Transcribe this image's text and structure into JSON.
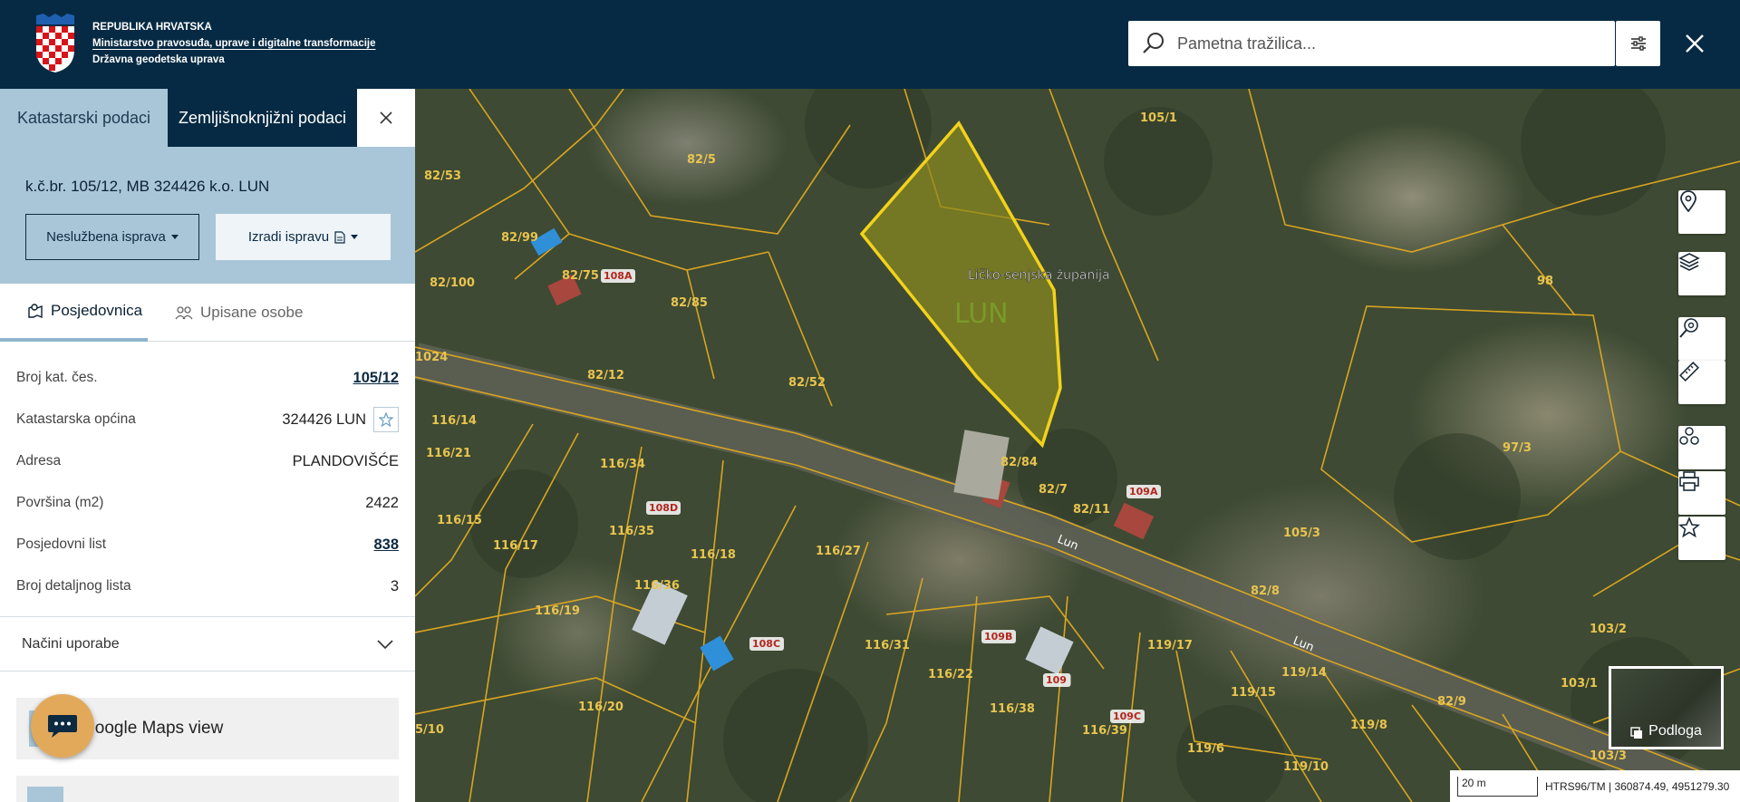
{
  "header": {
    "gov_line1": "REPUBLIKA HRVATSKA",
    "gov_line2": "Ministarstvo pravosuđa, uprave i digitalne transformacije",
    "gov_line3": "Državna geodetska uprava",
    "search_placeholder": "Pametna tražilica..."
  },
  "sidebar": {
    "tabs": [
      {
        "label": "Katastarski podaci"
      },
      {
        "label": "Zemljišnoknjižni podaci"
      }
    ],
    "parcel_title": "k.č.br. 105/12, MB 324426 k.o. LUN",
    "btn_unofficial": "Neslužbena isprava",
    "btn_create": "Izradi ispravu",
    "subtabs": [
      {
        "label": "Posjedovnica"
      },
      {
        "label": "Upisane osobe"
      }
    ],
    "info": [
      {
        "label": "Broj kat. čes.",
        "value": "105/12"
      },
      {
        "label": "Katastarska općina",
        "value": "324426 LUN"
      },
      {
        "label": "Adresa",
        "value": "PLANDOVIŠĆE"
      },
      {
        "label": "Površina (m2)",
        "value": "2422"
      },
      {
        "label": "Posjedovni list",
        "value": "838"
      },
      {
        "label": "Broj detaljnog lista",
        "value": "3"
      }
    ],
    "accordion_label": "Načini uporabe",
    "gmaps_label": "Google Maps view"
  },
  "map": {
    "county_label": "Ličko-senjska županija",
    "highlight_label": "LUN",
    "road_label": "Lun",
    "parcel_labels": [
      "105/1",
      "82/5",
      "82/53",
      "82/99",
      "82/75",
      "82/100",
      "82/85",
      "82/12",
      "82/52",
      "82/84",
      "82/7",
      "82/11",
      "116/14",
      "116/34",
      "116/15",
      "116/17",
      "116/35",
      "116/18",
      "116/27",
      "116/36",
      "116/19",
      "116/31",
      "116/22",
      "116/38",
      "116/20",
      "116/39",
      "105/3",
      "82/8",
      "98",
      "97/3",
      "103/2",
      "103/1",
      "82/9",
      "119/17",
      "119/14",
      "119/15",
      "119/8",
      "119/6",
      "119/10",
      "116/21",
      "103/3",
      "5/10",
      "1024"
    ],
    "building_labels": [
      "108A",
      "108D",
      "109A",
      "108C",
      "109B",
      "109",
      "109C"
    ],
    "basemap_label": "Podloga",
    "scale_label": "20 m",
    "coords": "HTRS96/TM | 360874.49, 4951279.30"
  },
  "colors": {
    "header_bg": "#062a43",
    "tab_light": "#a9c6d8",
    "parcel_line": "#d9a521",
    "highlight": "#f2d21b"
  }
}
